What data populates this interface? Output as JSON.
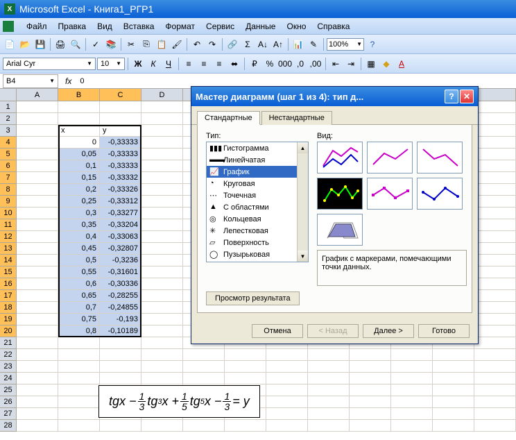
{
  "titlebar": {
    "app": "Microsoft Excel",
    "doc": "Книга1_РГР1"
  },
  "menu": {
    "file": "Файл",
    "edit": "Правка",
    "view": "Вид",
    "insert": "Вставка",
    "format": "Формат",
    "tools": "Сервис",
    "data": "Данные",
    "window": "Окно",
    "help": "Справка"
  },
  "toolbar": {
    "zoom": "100%"
  },
  "formatbar": {
    "font": "Arial Cyr",
    "size": "10"
  },
  "formula": {
    "cellref": "B4",
    "value": "0"
  },
  "cols": [
    "A",
    "B",
    "C",
    "D"
  ],
  "rows": [
    "1",
    "2",
    "3",
    "4",
    "5",
    "6",
    "7",
    "8",
    "9",
    "10",
    "11",
    "12",
    "13",
    "14",
    "15",
    "16",
    "17",
    "18",
    "19",
    "20",
    "21",
    "22",
    "23",
    "24",
    "25",
    "26",
    "27",
    "28"
  ],
  "header_row": {
    "x": "x",
    "y": "y"
  },
  "data_rows": [
    {
      "x": "0",
      "y": "-0,33333"
    },
    {
      "x": "0,05",
      "y": "-0,33333"
    },
    {
      "x": "0,1",
      "y": "-0,33333"
    },
    {
      "x": "0,15",
      "y": "-0,33332"
    },
    {
      "x": "0,2",
      "y": "-0,33326"
    },
    {
      "x": "0,25",
      "y": "-0,33312"
    },
    {
      "x": "0,3",
      "y": "-0,33277"
    },
    {
      "x": "0,35",
      "y": "-0,33204"
    },
    {
      "x": "0,4",
      "y": "-0,33063"
    },
    {
      "x": "0,45",
      "y": "-0,32807"
    },
    {
      "x": "0,5",
      "y": "-0,3236"
    },
    {
      "x": "0,55",
      "y": "-0,31601"
    },
    {
      "x": "0,6",
      "y": "-0,30336"
    },
    {
      "x": "0,65",
      "y": "-0,28255"
    },
    {
      "x": "0,7",
      "y": "-0,24855"
    },
    {
      "x": "0,75",
      "y": "-0,193"
    },
    {
      "x": "0,8",
      "y": "-0,10189"
    }
  ],
  "dialog": {
    "title": "Мастер диаграмм (шаг 1 из 4): тип д...",
    "tab1": "Стандартные",
    "tab2": "Нестандартные",
    "type_label": "Тип:",
    "view_label": "Вид:",
    "types": [
      "Гистограмма",
      "Линейчатая",
      "График",
      "Круговая",
      "Точечная",
      "С областями",
      "Кольцевая",
      "Лепестковая",
      "Поверхность",
      "Пузырьковая"
    ],
    "selected_type_index": 2,
    "description": "График с маркерами, помечающими точки данных.",
    "preview_btn": "Просмотр результата",
    "cancel": "Отмена",
    "back": "< Назад",
    "next": "Далее >",
    "finish": "Готово"
  },
  "equation": {
    "p1": "tgx −",
    "f1n": "1",
    "f1d": "3",
    "p2": "tg",
    "e1": "3",
    "p3": "x +",
    "f2n": "1",
    "f2d": "5",
    "p4": "tg",
    "e2": "5",
    "p5": "x −",
    "f3n": "1",
    "f3d": "3",
    "p6": "= y"
  }
}
